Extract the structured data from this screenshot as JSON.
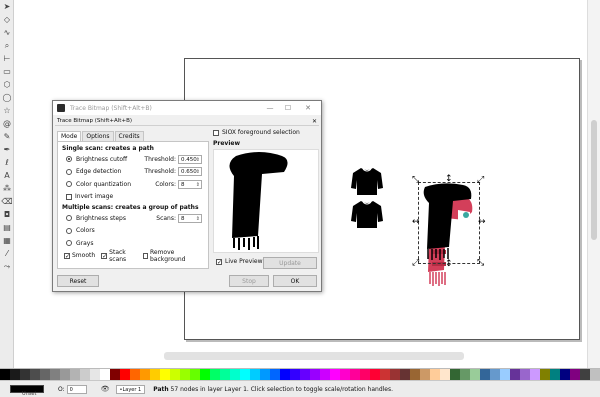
{
  "toolbox": {
    "tools": [
      {
        "name": "selector-icon",
        "glyph": "➤"
      },
      {
        "name": "node-icon",
        "glyph": "◇"
      },
      {
        "name": "tweak-icon",
        "glyph": "∿"
      },
      {
        "name": "zoom-icon",
        "glyph": "⌕"
      },
      {
        "name": "measure-icon",
        "glyph": "⊢"
      },
      {
        "name": "rectangle-icon",
        "glyph": "▭"
      },
      {
        "name": "box3d-icon",
        "glyph": "⬡"
      },
      {
        "name": "ellipse-icon",
        "glyph": "◯"
      },
      {
        "name": "star-icon",
        "glyph": "☆"
      },
      {
        "name": "spiral-icon",
        "glyph": "@"
      },
      {
        "name": "pencil-icon",
        "glyph": "✎"
      },
      {
        "name": "pen-icon",
        "glyph": "✒"
      },
      {
        "name": "calligraphy-icon",
        "glyph": "ℓ"
      },
      {
        "name": "text-icon",
        "glyph": "A"
      },
      {
        "name": "spray-icon",
        "glyph": "⁂"
      },
      {
        "name": "eraser-icon",
        "glyph": "⌫"
      },
      {
        "name": "bucket-icon",
        "glyph": "◘"
      },
      {
        "name": "gradient-icon",
        "glyph": "▤"
      },
      {
        "name": "mesh-icon",
        "glyph": "▦"
      },
      {
        "name": "dropper-icon",
        "glyph": "⁄"
      },
      {
        "name": "connector-icon",
        "glyph": "⤳"
      }
    ]
  },
  "dialog": {
    "window_title": "Trace Bitmap (Shift+Alt+B)",
    "panel_title": "Trace Bitmap (Shift+Alt+B)",
    "tabs": [
      "Mode",
      "Options",
      "Credits"
    ],
    "single_scan_title": "Single scan: creates a path",
    "brightness_cutoff": {
      "label": "Brightness cutoff",
      "param_label": "Threshold:",
      "value": "0.450",
      "selected": true
    },
    "edge_detection": {
      "label": "Edge detection",
      "param_label": "Threshold:",
      "value": "0.650",
      "selected": false
    },
    "color_quantization": {
      "label": "Color quantization",
      "param_label": "Colors:",
      "value": "8",
      "selected": false
    },
    "invert_image": {
      "label": "Invert image",
      "checked": false
    },
    "multiple_scans_title": "Multiple scans: creates a group of paths",
    "brightness_steps": {
      "label": "Brightness steps",
      "param_label": "Scans:",
      "value": "8",
      "selected": false
    },
    "colors": {
      "label": "Colors",
      "selected": false
    },
    "grays": {
      "label": "Grays",
      "selected": false
    },
    "smooth": {
      "label": "Smooth",
      "checked": true
    },
    "stack_scans": {
      "label": "Stack scans",
      "checked": true
    },
    "remove_background": {
      "label": "Remove background",
      "checked": false
    },
    "siox": {
      "label": "SIOX foreground selection",
      "checked": false
    },
    "preview_title": "Preview",
    "live_preview": {
      "label": "Live Preview",
      "checked": true
    },
    "update_label": "Update",
    "reset_label": "Reset",
    "stop_label": "Stop",
    "ok_label": "OK"
  },
  "statusbar": {
    "fill_label": "Unset",
    "opacity_label": "O:",
    "opacity_value": "0",
    "layer_label": "•Layer 1",
    "message_bold": "Path",
    "message": " 57 nodes in layer Layer 1. Click selection to toggle scale/rotation handles."
  },
  "colors": {
    "scarf_black": "#000000",
    "scarf_red": "#d33f5a",
    "scarf_red_dark": "#b42d44",
    "accent_teal": "#3aa8a0"
  },
  "palette": [
    "#000000",
    "#1a1a1a",
    "#333333",
    "#4d4d4d",
    "#666666",
    "#808080",
    "#999999",
    "#b3b3b3",
    "#cccccc",
    "#e6e6e6",
    "#ffffff",
    "#800000",
    "#ff0000",
    "#ff6600",
    "#ff9900",
    "#ffcc00",
    "#ffff00",
    "#ccff00",
    "#99ff00",
    "#66ff00",
    "#00ff00",
    "#00ff66",
    "#00ff99",
    "#00ffcc",
    "#00ffff",
    "#00ccff",
    "#0099ff",
    "#0066ff",
    "#0000ff",
    "#3300ff",
    "#6600ff",
    "#9900ff",
    "#cc00ff",
    "#ff00ff",
    "#ff00cc",
    "#ff0099",
    "#ff0066",
    "#ff0033",
    "#cc3333",
    "#993333",
    "#663333",
    "#996633",
    "#cc9966",
    "#ffcc99",
    "#ffe6cc",
    "#336633",
    "#669966",
    "#99cc99",
    "#336699",
    "#6699cc",
    "#99ccff",
    "#663399",
    "#9966cc",
    "#cc99ff",
    "#808000",
    "#008080",
    "#000080",
    "#800080",
    "#404040",
    "#c0c0c0"
  ]
}
